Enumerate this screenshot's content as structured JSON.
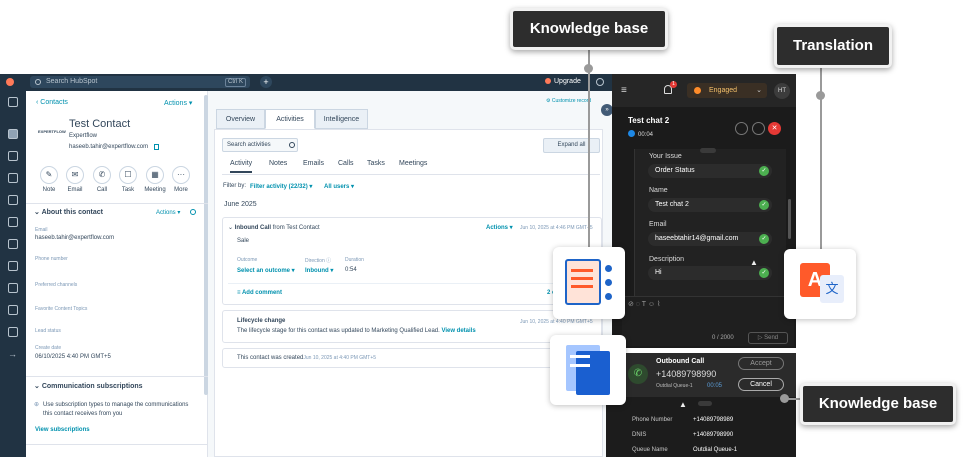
{
  "crm": {
    "search_placeholder": "Search HubSpot",
    "search_shortcut": "Ctrl K",
    "plus": "+",
    "upgrade": "Upgrade",
    "back_link": "Contacts",
    "actions_label": "Actions ▾",
    "contact": {
      "name": "Test Contact",
      "company": "Expertflow",
      "email": "haseeb.tahir@expertflow.com",
      "logo_text": "EXPERTFLOW"
    },
    "quick_actions": [
      {
        "label": "Note",
        "icon": "✎"
      },
      {
        "label": "Email",
        "icon": "✉"
      },
      {
        "label": "Call",
        "icon": "✆"
      },
      {
        "label": "Task",
        "icon": "☐"
      },
      {
        "label": "Meeting",
        "icon": "▦"
      },
      {
        "label": "More",
        "icon": "···"
      }
    ],
    "about": {
      "title": "About this contact",
      "actions": "Actions ▾",
      "email_label": "Email",
      "email_value": "haseeb.tahir@expertflow.com",
      "phone_label": "Phone number",
      "preferred_label": "Preferred channels",
      "topics_label": "Favorite Content Topics",
      "lead_label": "Lead status",
      "create_label": "Create date",
      "create_value": "06/10/2025 4:40 PM GMT+5"
    },
    "subscriptions": {
      "title": "Communication subscriptions",
      "text": "Use subscription types to manage the communications this contact receives from you",
      "link": "View subscriptions"
    },
    "customize": "Customize record",
    "tabs": [
      "Overview",
      "Activities",
      "Intelligence"
    ],
    "search_activities": "Search activities",
    "expand_all": "Expand all",
    "subtabs": [
      "Activity",
      "Notes",
      "Emails",
      "Calls",
      "Tasks",
      "Meetings"
    ],
    "filter_by": "Filter by:",
    "filter_activity": "Filter activity (22/32) ▾",
    "all_users": "All users ▾",
    "month": "June 2025",
    "inbound": {
      "title": "Inbound Call",
      "from": "from Test Contact",
      "actions": "Actions ▾",
      "date": "Jun 10, 2025 at 4:46 PM GMT+5",
      "note": "Sale",
      "outcome_label": "Outcome",
      "outcome_value": "Select an outcome ▾",
      "direction_label": "Direction",
      "direction_value": "Inbound ▾",
      "duration_label": "Duration",
      "duration_value": "0:54",
      "add_comment": "Add comment",
      "comments": "2 c"
    },
    "lifecycle": {
      "title": "Lifecycle change",
      "date": "Jun 10, 2025 at 4:40 PM GMT+5",
      "text": "The lifecycle stage for this contact was updated to Marketing Qualified Lead.",
      "link": "View details"
    },
    "created": {
      "text": "This contact was created",
      "date": "Jun 10, 2025 at 4:40 PM GMT+5"
    }
  },
  "chat": {
    "status": "Engaged",
    "avatar": "HT",
    "notif": "1",
    "title": "Test chat 2",
    "timer": "00:04",
    "fields": [
      {
        "label": "Your Issue",
        "value": "Order Status"
      },
      {
        "label": "Name",
        "value": "Test chat 2"
      },
      {
        "label": "Email",
        "value": "haseebtahir14@gmail.com"
      },
      {
        "label": "Description",
        "value": "Hi"
      }
    ],
    "counter": "0 / 2000",
    "send": "Send"
  },
  "call": {
    "title": "Outbound Call",
    "number": "+14089798990",
    "queue": "Outdial Queue-1",
    "timer": "00:05",
    "accept": "Accept",
    "cancel": "Cancel",
    "rows": [
      {
        "label": "Phone Number",
        "value": "+14089798989"
      },
      {
        "label": "DNIS",
        "value": "+14089798990"
      },
      {
        "label": "Queue Name",
        "value": "Outdial Queue-1"
      }
    ]
  },
  "callouts": {
    "kb_top": "Knowledge base",
    "translation": "Translation",
    "kb_bottom": "Knowledge base"
  },
  "colors": {
    "hubspot_nav": "#213343",
    "link": "#0091ae",
    "chat_bg": "#1b1b1b",
    "engaged": "#f4c06a",
    "check": "#4caf50",
    "end_call": "#e53935"
  }
}
